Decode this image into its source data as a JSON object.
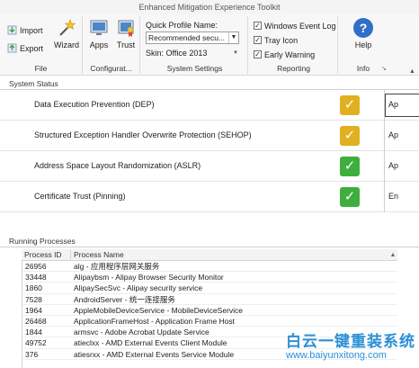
{
  "window": {
    "title": "Enhanced Mitigation Experience Toolkit"
  },
  "ribbon": {
    "file": {
      "import_label": "Import",
      "export_label": "Export",
      "wizard_label": "Wizard",
      "group_label": "File"
    },
    "configuration": {
      "apps_label": "Apps",
      "trust_label": "Trust",
      "group_label": "Configurat..."
    },
    "system_settings": {
      "quick_profile_label": "Quick Profile Name:",
      "quick_profile_value": "Recommended secu...",
      "skin_label": "Skin: Office 2013",
      "group_label": "System Settings"
    },
    "reporting": {
      "windows_event_log": "Windows Event Log",
      "tray_icon": "Tray Icon",
      "early_warning": "Early Warning",
      "group_label": "Reporting"
    },
    "info": {
      "help_label": "Help",
      "group_label": "Info"
    }
  },
  "system_status": {
    "header": "System Status",
    "rows": [
      {
        "label": "Data Execution Prevention (DEP)",
        "state": "Ap"
      },
      {
        "label": "Structured Exception Handler Overwrite Protection (SEHOP)",
        "state": "Ap"
      },
      {
        "label": "Address Space Layout Randomization (ASLR)",
        "state": "Ap"
      },
      {
        "label": "Certificate Trust (Pinning)",
        "state": "En"
      }
    ],
    "colors": {
      "warn": "#e0b020",
      "ok": "#3fae3f"
    }
  },
  "running_processes": {
    "header": "Running Processes",
    "columns": [
      "Process ID",
      "Process Name"
    ],
    "rows": [
      {
        "id": "26956",
        "name": "alg - 应用程序层网关服务"
      },
      {
        "id": "33448",
        "name": "Alipaybsm - Alipay Browser Security Monitor"
      },
      {
        "id": "1860",
        "name": "AlipaySecSvc - Alipay security service"
      },
      {
        "id": "7528",
        "name": "AndroidServer - 统一连接服务"
      },
      {
        "id": "1964",
        "name": "AppleMobileDeviceService - MobileDeviceService"
      },
      {
        "id": "26468",
        "name": "ApplicationFrameHost - Application Frame Host"
      },
      {
        "id": "1844",
        "name": "armsvc - Adobe Acrobat Update Service"
      },
      {
        "id": "49752",
        "name": "atieclxx - AMD External Events Client Module"
      },
      {
        "id": "376",
        "name": "atiesrxx - AMD External Events Service Module"
      }
    ]
  },
  "watermark": {
    "text_cn": "白云一键重装系统",
    "url": "www.baiyunxitong.com"
  }
}
